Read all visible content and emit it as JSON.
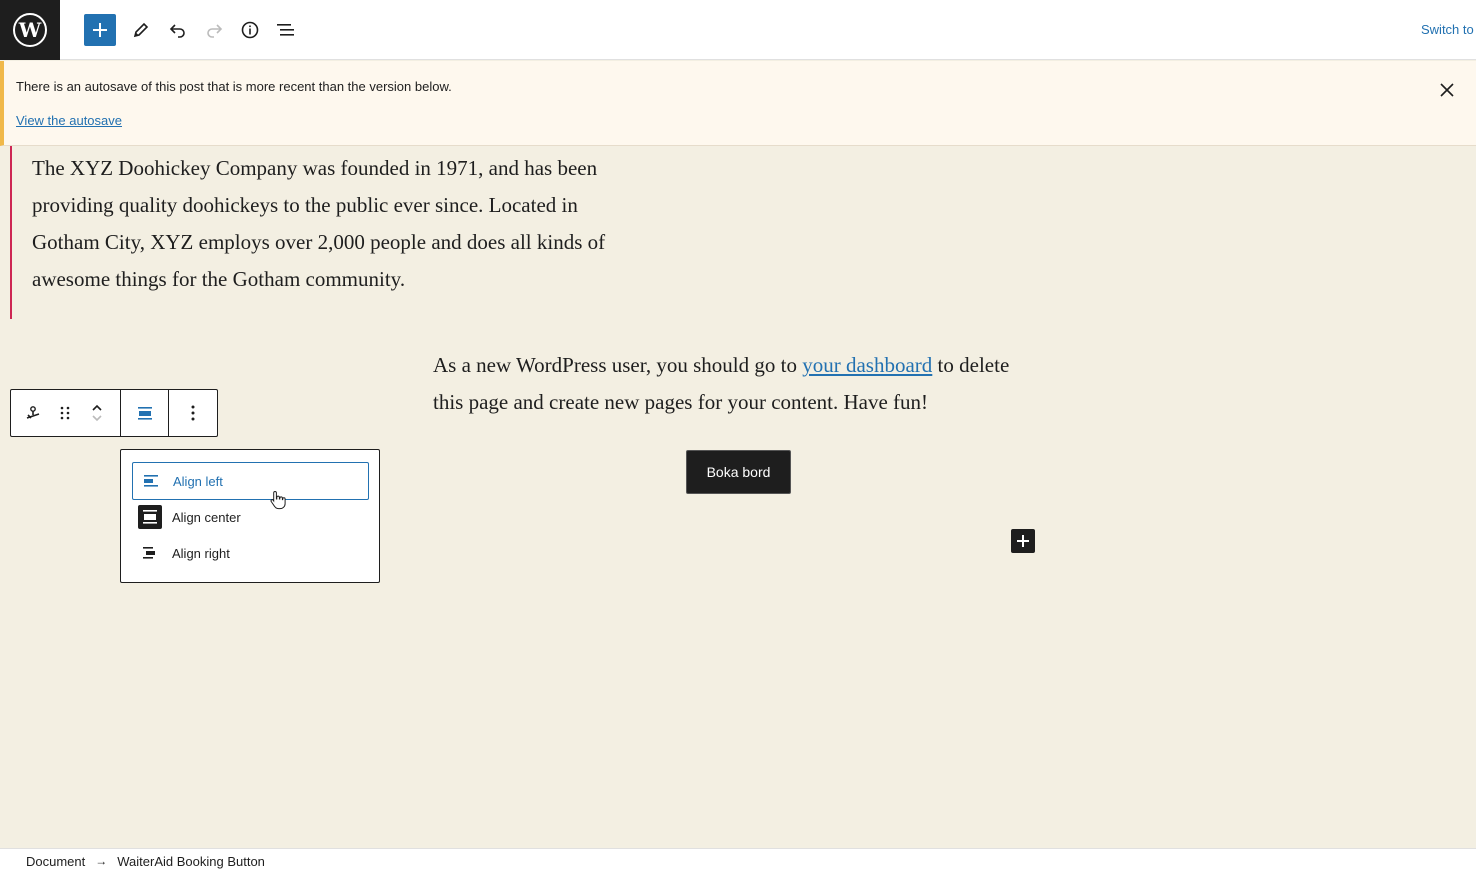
{
  "header": {
    "logo_icon": "wordpress-logo-icon",
    "logo_letter": "W",
    "tools": [
      "add-block-icon",
      "edit-icon",
      "undo-icon",
      "redo-icon",
      "info-icon",
      "list-view-icon"
    ],
    "switch_label": "Switch to"
  },
  "notice": {
    "message": "There is an autosave of this post that is more recent than the version below.",
    "link_label": "View the autosave"
  },
  "content": {
    "quote_text": "The XYZ Doohickey Company was founded in 1971, and has been providing quality doohickeys to the public ever since. Located in Gotham City, XYZ employs over 2,000 people and does all kinds of awesome things for the Gotham community.",
    "para_before_link": "As a new WordPress user, you should go to ",
    "para_link": "your dashboard",
    "para_after_link": " to delete this page and create new pages for your content. Have fun!",
    "button_label": "Boka bord"
  },
  "block_toolbar": {
    "tools": [
      "block-type-icon",
      "drag-handle-icon",
      "move-up-icon",
      "move-down-icon",
      "align-icon",
      "more-options-icon"
    ]
  },
  "align_menu": {
    "items": [
      {
        "label": "Align left",
        "icon": "align-left-icon",
        "active": true
      },
      {
        "label": "Align center",
        "icon": "align-center-icon",
        "active": false
      },
      {
        "label": "Align right",
        "icon": "align-right-icon",
        "active": false
      }
    ]
  },
  "breadcrumb": {
    "items": [
      "Document",
      "WaiterAid Booking Button"
    ]
  },
  "colors": {
    "accent": "#2271b1",
    "canvas": "#f3efe2",
    "notice_bg": "#fef8ee",
    "notice_border": "#f0b849",
    "quote_border": "#cd2653"
  }
}
